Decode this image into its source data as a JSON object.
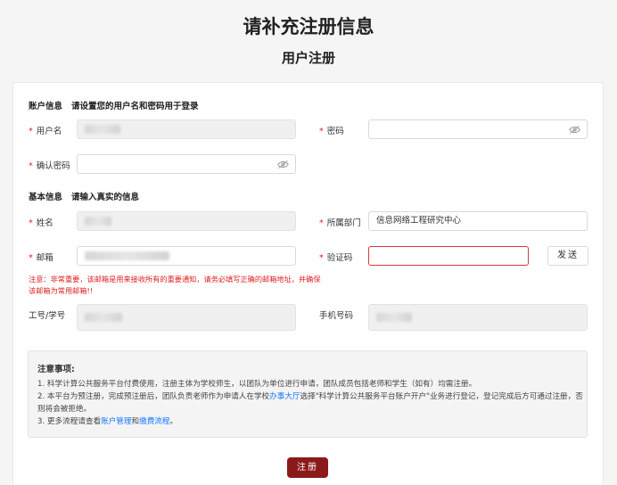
{
  "header": {
    "title": "请补充注册信息",
    "subtitle": "用户注册"
  },
  "account_section": {
    "title": "账户信息",
    "description": "请设置您的用户名和密码用于登录",
    "username_label": "用户名",
    "password_label": "密码",
    "confirm_password_label": "确认密码"
  },
  "basic_section": {
    "title": "基本信息",
    "description": "请输入真实的信息",
    "name_label": "姓名",
    "department_label": "所属部门",
    "department_value": "信息网络工程研究中心",
    "email_label": "邮箱",
    "verify_code_label": "验证码",
    "send_button": "发送",
    "email_warning": "注意：非常重要，该邮箱是用来接收所有的重要通知，请务必填写正确的邮箱地址，并确保该邮箱为常用邮箱!!",
    "staff_id_label": "工号/学号",
    "phone_label": "手机号码"
  },
  "notice": {
    "title": "注意事项:",
    "line1": "1. 科学计算公共服务平台付费使用，注册主体为学校师生，以团队为单位进行申请，团队成员包括老师和学生（如有）均需注册。",
    "line2_prefix": "2. 本平台为预注册，完成预注册后，团队负责老师作为申请人在学校",
    "line2_link": "办事大厅",
    "line2_suffix": "选择\"科学计算公共服务平台账户开户\"业务进行登记，登记完成后方可通过注册，否则将会被拒绝。",
    "line3_prefix": "3. 更多流程请查看",
    "line3_link1": "账户管理",
    "line3_mid": "和",
    "line3_link2": "缴费流程",
    "line3_suffix": "。"
  },
  "footer": {
    "register_button": "注册"
  },
  "required_mark": "*",
  "colors": {
    "accent": "#8b1a1a",
    "link": "#1677ff",
    "required": "#e02020",
    "error_border": "#d9363e"
  },
  "icons": {
    "password_toggle": "eye-slash-icon"
  }
}
